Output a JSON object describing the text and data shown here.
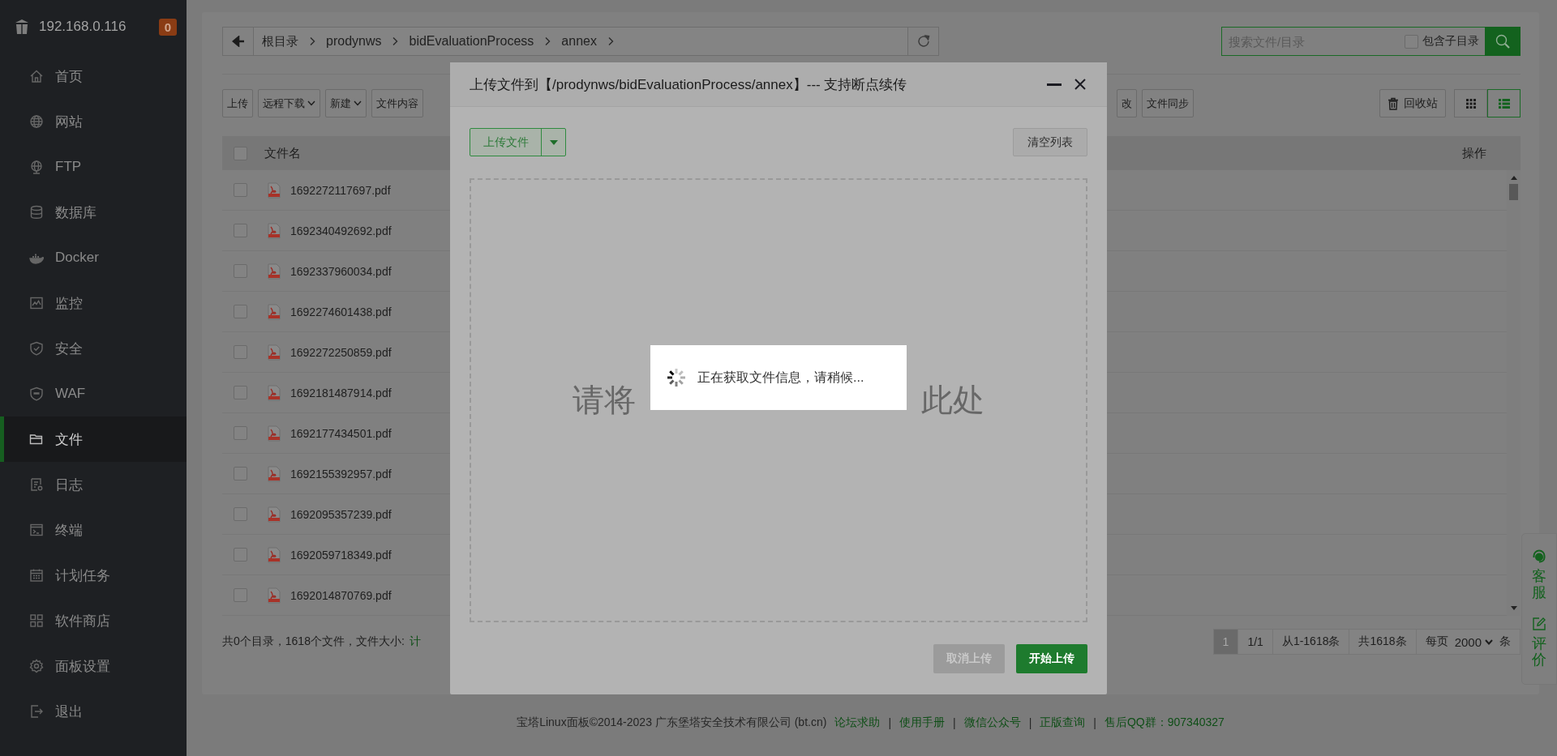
{
  "sidebar": {
    "host": "192.168.0.116",
    "badge": "0",
    "items": [
      {
        "label": "首页",
        "selected": false
      },
      {
        "label": "网站",
        "selected": false
      },
      {
        "label": "FTP",
        "selected": false
      },
      {
        "label": "数据库",
        "selected": false
      },
      {
        "label": "Docker",
        "selected": false
      },
      {
        "label": "监控",
        "selected": false
      },
      {
        "label": "安全",
        "selected": false
      },
      {
        "label": "WAF",
        "selected": false
      },
      {
        "label": "文件",
        "selected": true
      },
      {
        "label": "日志",
        "selected": false
      },
      {
        "label": "终端",
        "selected": false
      },
      {
        "label": "计划任务",
        "selected": false
      },
      {
        "label": "软件商店",
        "selected": false
      },
      {
        "label": "面板设置",
        "selected": false
      },
      {
        "label": "退出",
        "selected": false
      }
    ]
  },
  "breadcrumb": {
    "items": [
      "根目录",
      "prodynws",
      "bidEvaluationProcess",
      "annex"
    ]
  },
  "search": {
    "placeholder": "搜索文件/目录",
    "include_subdirs": {
      "label": "包含子目录",
      "checked": false
    }
  },
  "toolbar": {
    "left": [
      {
        "label": "上传",
        "dropdown": false
      },
      {
        "label": "远程下载",
        "dropdown": true
      },
      {
        "label": "新建",
        "dropdown": true
      },
      {
        "label": "文件内容",
        "dropdown": false
      }
    ],
    "right": [
      "改",
      "文件同步"
    ],
    "recycle_bin": "回收站",
    "views": [
      {
        "kind": "grid",
        "selected": false
      },
      {
        "kind": "list",
        "selected": true
      }
    ]
  },
  "table": {
    "columns": [
      "文件名",
      "操作"
    ],
    "header_checked": false,
    "rows": [
      {
        "name": "1692272117697.pdf",
        "checked": false
      },
      {
        "name": "1692340492692.pdf",
        "checked": false
      },
      {
        "name": "1692337960034.pdf",
        "checked": false
      },
      {
        "name": "1692274601438.pdf",
        "checked": false
      },
      {
        "name": "1692272250859.pdf",
        "checked": false
      },
      {
        "name": "1692181487914.pdf",
        "checked": false
      },
      {
        "name": "1692177434501.pdf",
        "checked": false
      },
      {
        "name": "1692155392957.pdf",
        "checked": false
      },
      {
        "name": "1692095357239.pdf",
        "checked": false
      },
      {
        "name": "1692059718349.pdf",
        "checked": false
      },
      {
        "name": "1692014870769.pdf",
        "checked": false
      }
    ]
  },
  "summary": {
    "text": "共0个目录，1618个文件，文件大小:",
    "link": "计"
  },
  "pagination": {
    "pages": [
      {
        "label": "1",
        "selected": true
      }
    ],
    "info": [
      "1/1",
      "从1-1618条",
      "共1618条"
    ],
    "per_page_label": "每页",
    "per_page": "2000",
    "unit": "条"
  },
  "footer": {
    "separator": "|",
    "copyright": "宝塔Linux面板©2014-2023 广东堡塔安全技术有限公司 (bt.cn)",
    "links": [
      "论坛求助",
      "使用手册",
      "微信公众号",
      "正版查询",
      "售后QQ群：907340327"
    ]
  },
  "float_panel": [
    {
      "kind": "support",
      "label": "客服"
    },
    {
      "kind": "review",
      "label": "评价"
    }
  ],
  "dialog": {
    "title": "上传文件到【/prodynws/bidEvaluationProcess/annex】--- 支持断点续传",
    "upload_button": "上传文件",
    "clear_button": "清空列表",
    "drop_text_left": "请将",
    "drop_text_right": "此处",
    "loading": "正在获取文件信息，请稍候...",
    "cancel_button": {
      "label": "取消上传",
      "disabled": true
    },
    "start_button": "开始上传"
  }
}
